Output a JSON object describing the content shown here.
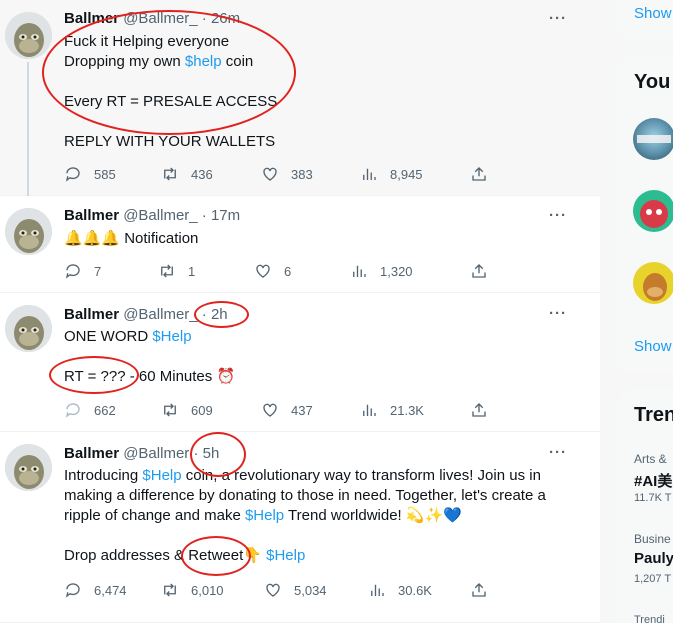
{
  "tweets": [
    {
      "name": "Ballmer",
      "handle": "@Ballmer_",
      "sep": "·",
      "time": "26m",
      "lines": [
        "Fuck it Helping everyone",
        "Dropping my own ",
        "$help",
        " coin",
        "",
        "Every RT = PRESALE ACCESS",
        "",
        "REPLY WITH YOUR WALLETS"
      ],
      "replies": "585",
      "retweets": "436",
      "likes": "383",
      "views": "8,945"
    },
    {
      "name": "Ballmer",
      "handle": "@Ballmer_",
      "sep": "·",
      "time": "17m",
      "text": "🔔🔔🔔 Notification",
      "replies": "7",
      "retweets": "1",
      "likes": "6",
      "views": "1,320"
    },
    {
      "name": "Ballmer",
      "handle": "@Ballmer_",
      "sep": "·",
      "time": "2h",
      "line1a": "ONE WORD ",
      "line1b": "$Help",
      "line2": "RT = ??? - 60 Minutes ⏰",
      "replies": "662",
      "retweets": "609",
      "likes": "437",
      "views": "21.3K"
    },
    {
      "name": "Ballmer",
      "handle": "@Ballmer",
      "sep": "·",
      "time": "5h",
      "p1a": "Introducing ",
      "p1b": "$Help",
      "p1c": " coin, a revolutionary way to transform lives! Join us in making a difference by donating to those in need. Together, let's create a ripple of change and make ",
      "p1d": "$Help",
      "p1e": " Trend worldwide! 💫✨💙",
      "p2a": "Drop addresses & Retweet👇 ",
      "p2b": "$Help",
      "replies": "6,474",
      "retweets": "6,010",
      "likes": "5,034",
      "views": "30.6K"
    }
  ],
  "more_label": "···",
  "sidebar": {
    "show_more_top": "Show",
    "who_to_follow_title": "You",
    "show_more_follow": "Show",
    "trends_title": "Tren",
    "trend1_category": "Arts &",
    "trend1_name": "#AI美",
    "trend1_count": "11.7K T",
    "trend2_category": "Busine",
    "trend2_name": "Pauly",
    "trend2_count": "1,207 T",
    "trend3_category": "Trendi"
  },
  "colors": {
    "link": "#1d9bf0",
    "annotation_red": "#e0231f",
    "muted": "#536471"
  }
}
